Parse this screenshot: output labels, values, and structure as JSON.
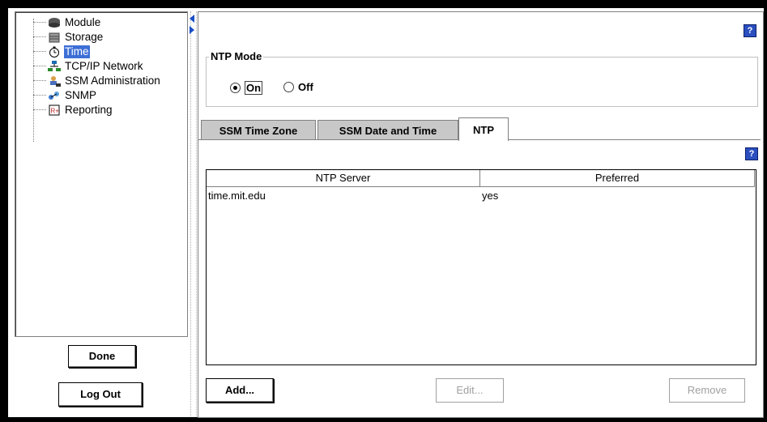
{
  "tree": {
    "items": [
      {
        "label": "Module",
        "icon": "module-icon"
      },
      {
        "label": "Storage",
        "icon": "storage-icon"
      },
      {
        "label": "Time",
        "icon": "clock-icon",
        "selected": true
      },
      {
        "label": "TCP/IP Network",
        "icon": "network-icon"
      },
      {
        "label": "SSM Administration",
        "icon": "admin-icon"
      },
      {
        "label": "SNMP",
        "icon": "snmp-icon"
      },
      {
        "label": "Reporting",
        "icon": "report-icon"
      }
    ]
  },
  "left_buttons": {
    "done": "Done",
    "logout": "Log Out"
  },
  "ntp_mode": {
    "legend": "NTP Mode",
    "on_label": "On",
    "off_label": "Off",
    "selected": "On"
  },
  "tabs": [
    {
      "label": "SSM Time Zone",
      "active": false
    },
    {
      "label": "SSM Date and Time",
      "active": false
    },
    {
      "label": "NTP",
      "active": true
    }
  ],
  "ntp_table": {
    "columns": [
      "NTP Server",
      "Preferred"
    ],
    "rows": [
      {
        "server": "time.mit.edu",
        "preferred": "yes"
      }
    ]
  },
  "table_buttons": {
    "add": "Add...",
    "edit": "Edit...",
    "remove": "Remove"
  },
  "help_icon_label": "?",
  "colors": {
    "selection": "#3d6fd6",
    "help_icon": "#2b4fbf",
    "tab_inactive": "#c8c8c8"
  }
}
